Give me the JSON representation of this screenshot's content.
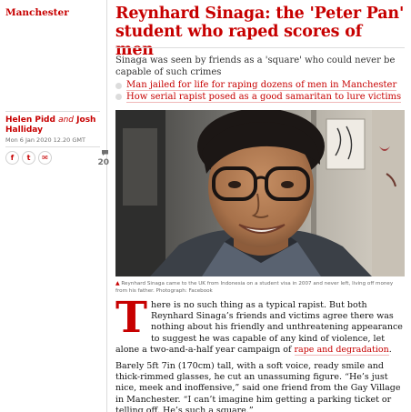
{
  "section": "Manchester",
  "headline": "Reynhard Sinaga: the 'Peter Pan' student who raped scores of men",
  "standfirst": "Sinaga was seen by friends as a 'square' who could never be capable of such crimes",
  "related": [
    "Man jailed for life for raping dozens of men in Manchester",
    "How serial rapist posed as a good samaritan to lure victims"
  ],
  "byline": {
    "author1": "Helen Pidd",
    "and": "and",
    "author2": "Josh Halliday"
  },
  "dateline": "Mon 6 Jan 2020 12.20 GMT",
  "share": {
    "facebook": "f",
    "twitter": "t",
    "email": "✉"
  },
  "comments": {
    "icon": "speech-bubble-icon",
    "count": "20"
  },
  "caption": {
    "marker": "▲",
    "text": "Reynhard Sinaga came to the UK from Indonesia on a student visa in 2007 and never left, living off money from his father. Photograph: Facebook"
  },
  "body": {
    "dropcap": "T",
    "para1": "here is no such thing as a typical rapist. But both Reynhard Sinaga’s friends and victims agree there was nothing about his friendly and unthreatening appearance to suggest he was capable of any kind of violence, let alone a two-and-a-half year campaign of ",
    "para1_link": "rape and degradation",
    "para1_end": ".",
    "para2": "Barely 5ft 7in (170cm) tall, with a soft voice, ready smile and thick-rimmed glasses, he cut an unassuming figure. “He’s just nice, meek and inoffensive,” said one friend from the Gay Village in Manchester. “I can’t imagine him getting a parking ticket or telling off. He’s such a square.”"
  },
  "colors": {
    "accent": "#c70000",
    "rule": "#dcdcdc"
  }
}
